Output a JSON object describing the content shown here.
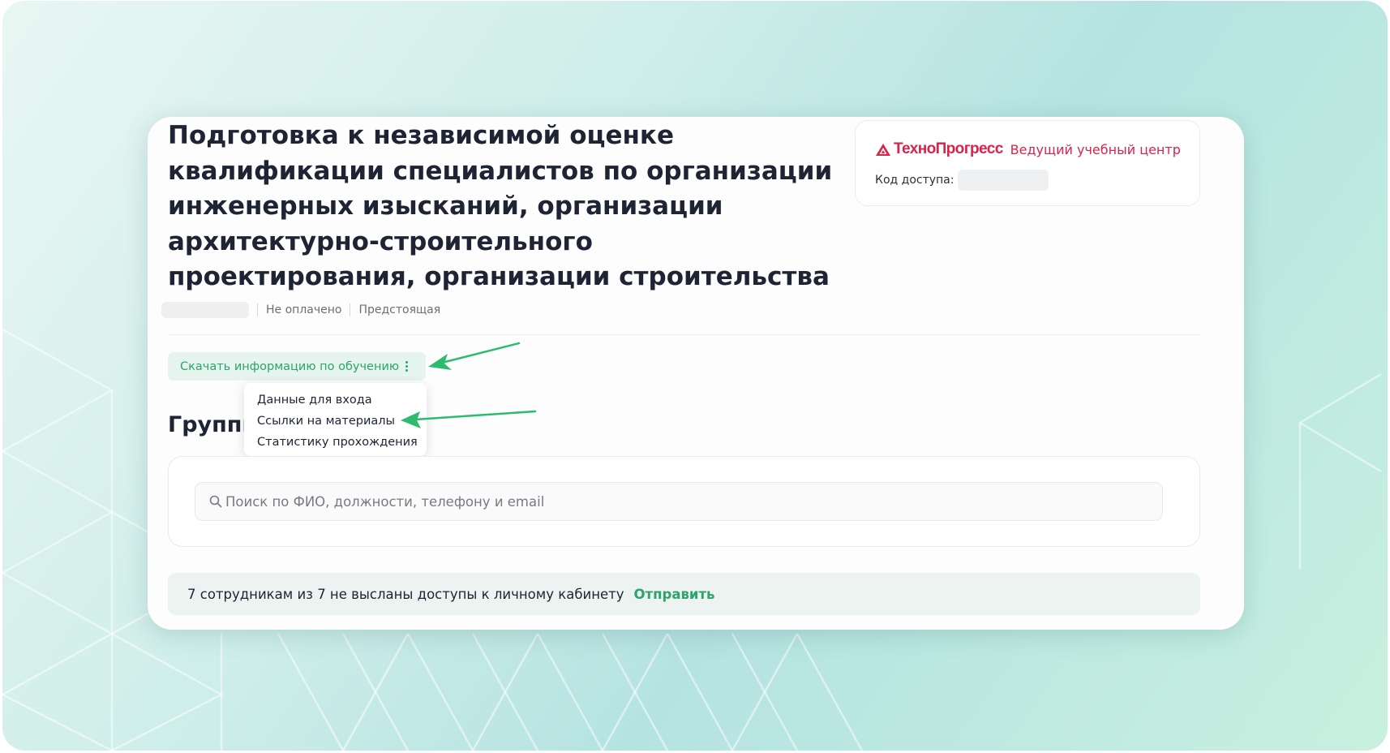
{
  "course": {
    "title": "Подготовка к независимой оценке квалификации специалистов по организации инженерных изысканий, организации архитектурно-строительного проектирования, организации строительства",
    "payment_status": "Не оплачено",
    "schedule_status": "Предстоящая"
  },
  "provider": {
    "logo_icon": "triangle-logo-icon",
    "name": "ТехноПрогресс",
    "tagline": "Ведущий учебный центр",
    "access_code_label": "Код доступа:"
  },
  "download": {
    "label": "Скачать информацию по обучению",
    "menu_icon": "kebab-menu-icon",
    "menu_items": [
      {
        "label": "Данные для входа"
      },
      {
        "label": "Ссылки на материалы"
      },
      {
        "label": "Статистику прохождения"
      }
    ]
  },
  "groups": {
    "heading": "Группы"
  },
  "search": {
    "icon": "search-icon",
    "placeholder": "Поиск по ФИО, должности, телефону и email"
  },
  "notice": {
    "text": "7 сотрудникам из 7 не высланы доступы к личному кабинету",
    "action": "Отправить"
  },
  "colors": {
    "brand": "#d9234b",
    "accent_green": "#2ea36a",
    "annotation_arrow": "#2dbb6e",
    "text_primary": "#1e2433"
  }
}
